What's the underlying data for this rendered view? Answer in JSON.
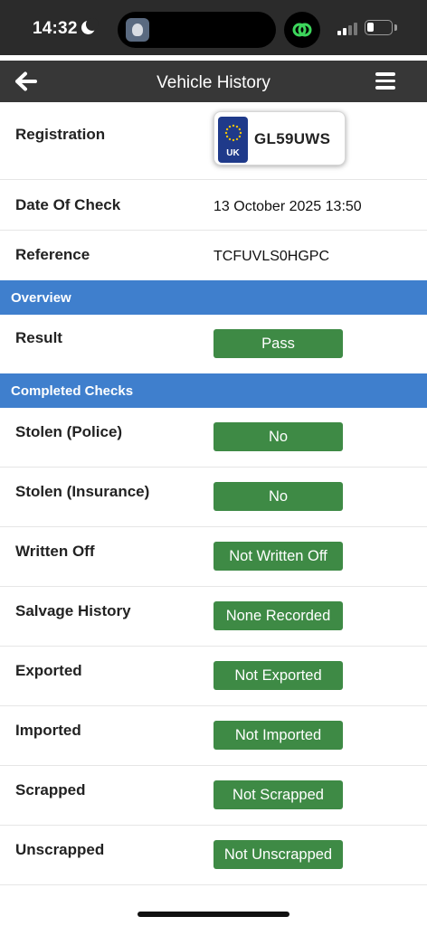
{
  "status_bar": {
    "time": "14:32",
    "icons": [
      "moon-icon",
      "linked-circles-icon",
      "signal-icon",
      "battery-icon"
    ]
  },
  "header": {
    "title": "Vehicle History",
    "back_icon": "back-arrow-icon",
    "menu_icon": "hamburger-menu-icon"
  },
  "details": {
    "registration_label": "Registration",
    "plate_country": "UK",
    "plate_number": "GL59UWS",
    "date_label": "Date Of Check",
    "date_value": "13 October 2025 13:50",
    "reference_label": "Reference",
    "reference_value": "TCFUVLS0HGPC"
  },
  "overview": {
    "title": "Overview",
    "result_label": "Result",
    "result_value": "Pass"
  },
  "checks": {
    "title": "Completed Checks",
    "items": [
      {
        "label": "Stolen (Police)",
        "value": "No"
      },
      {
        "label": "Stolen (Insurance)",
        "value": "No"
      },
      {
        "label": "Written Off",
        "value": "Not Written Off"
      },
      {
        "label": "Salvage History",
        "value": "None Recorded"
      },
      {
        "label": "Exported",
        "value": "Not Exported"
      },
      {
        "label": "Imported",
        "value": "Not Imported"
      },
      {
        "label": "Scrapped",
        "value": "Not Scrapped"
      },
      {
        "label": "Unscrapped",
        "value": "Not Unscrapped"
      }
    ]
  },
  "colors": {
    "header_bg": "#373737",
    "section_bg": "#3f7fcd",
    "pill_bg": "#3e8a45",
    "plate_band": "#1f3a8a"
  }
}
